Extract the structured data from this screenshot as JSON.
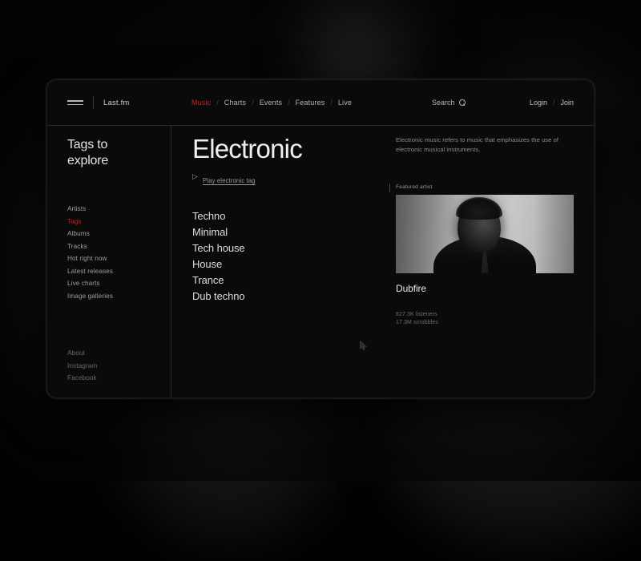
{
  "header": {
    "brand": "Last.fm",
    "menu_icon": "hamburger-icon",
    "nav": [
      {
        "label": "Music",
        "active": true
      },
      {
        "label": "Charts",
        "active": false
      },
      {
        "label": "Events",
        "active": false
      },
      {
        "label": "Features",
        "active": false
      },
      {
        "label": "Live",
        "active": false
      }
    ],
    "nav_separator": "/",
    "search": {
      "label": "Search",
      "icon": "search-icon"
    },
    "auth": {
      "login": "Login",
      "separator": "/",
      "join": "Join"
    }
  },
  "sidebar": {
    "title": "Tags to explore",
    "items": [
      {
        "label": "Artists",
        "active": false
      },
      {
        "label": "Tags",
        "active": true
      },
      {
        "label": "Albums",
        "active": false
      },
      {
        "label": "Tracks",
        "active": false
      },
      {
        "label": "Hot right now",
        "active": false
      },
      {
        "label": "Latest releases",
        "active": false
      },
      {
        "label": "Live charts",
        "active": false
      },
      {
        "label": "Image galleries",
        "active": false
      }
    ],
    "footer": [
      {
        "label": "About"
      },
      {
        "label": "Instagram"
      },
      {
        "label": "Facebook"
      }
    ]
  },
  "main": {
    "title": "Electronic",
    "play": {
      "icon": "play-triangle-icon",
      "label": "Play electronic tag"
    },
    "description": "Electronic music refers to music that emphasizes the use of electronic musical instruments.",
    "genres": [
      {
        "label": "Techno"
      },
      {
        "label": "Minimal"
      },
      {
        "label": "Tech house"
      },
      {
        "label": "House"
      },
      {
        "label": "Trance"
      },
      {
        "label": "Dub techno"
      }
    ],
    "featured": {
      "label": "Featured artist",
      "name": "Dubfire",
      "stats": [
        {
          "value": "627.3K listeners"
        },
        {
          "value": "17.3M scrobbles"
        }
      ]
    }
  },
  "colors": {
    "accent_red": "#cc2020",
    "screen_bg": "#0a0a0a",
    "text_primary": "#e8e8e8",
    "text_muted": "#8d8d8d",
    "border": "#2a2a2a"
  }
}
